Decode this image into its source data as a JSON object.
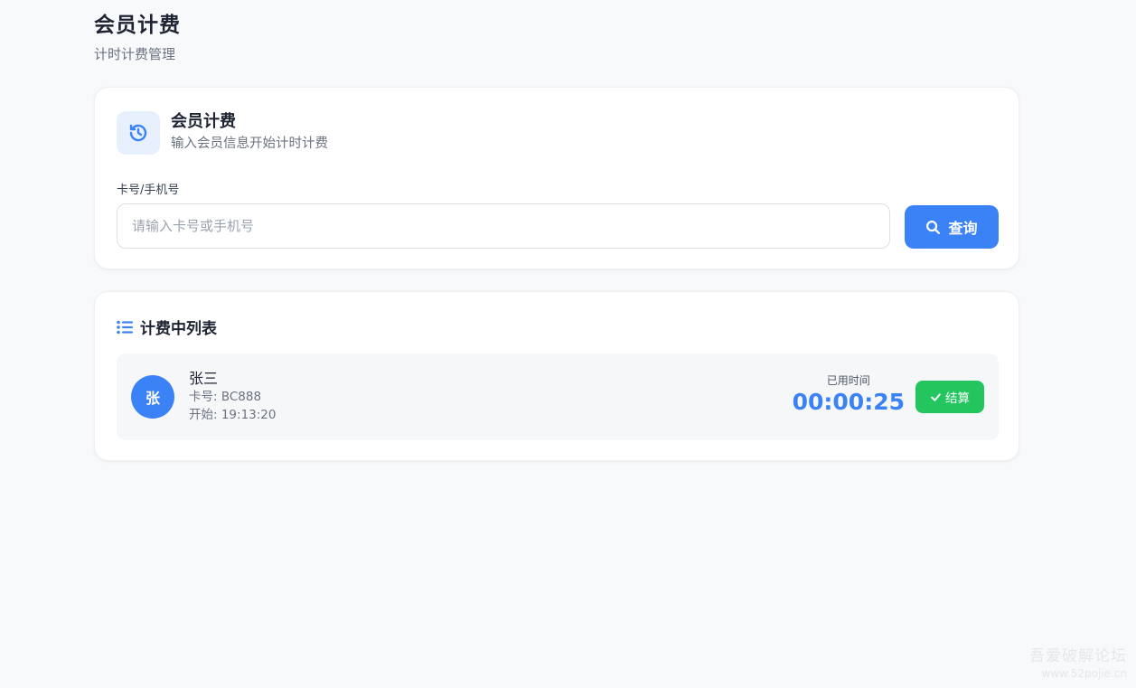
{
  "page": {
    "title": "会员计费",
    "subtitle": "计时计费管理"
  },
  "search_card": {
    "icon": "history-icon",
    "title": "会员计费",
    "subtitle": "输入会员信息开始计时计费",
    "field_label": "卡号/手机号",
    "input_value": "",
    "input_placeholder": "请输入卡号或手机号",
    "button_label": "查询",
    "button_icon": "search-icon"
  },
  "list_card": {
    "icon": "list-icon",
    "title": "计费中列表",
    "items": [
      {
        "avatar_text": "张",
        "name": "张三",
        "card_line": "卡号: BC888",
        "start_line": "开始: 19:13:20",
        "elapsed_label": "已用时间",
        "elapsed_time": "00:00:25",
        "action_label": "结算",
        "action_icon": "check-icon"
      }
    ]
  },
  "watermark": {
    "line1": "吾爱破解论坛",
    "line2": "www.52pojie.cn"
  },
  "colors": {
    "accent": "#3b82f6",
    "success": "#22c55e",
    "background": "#f8f9fb"
  }
}
